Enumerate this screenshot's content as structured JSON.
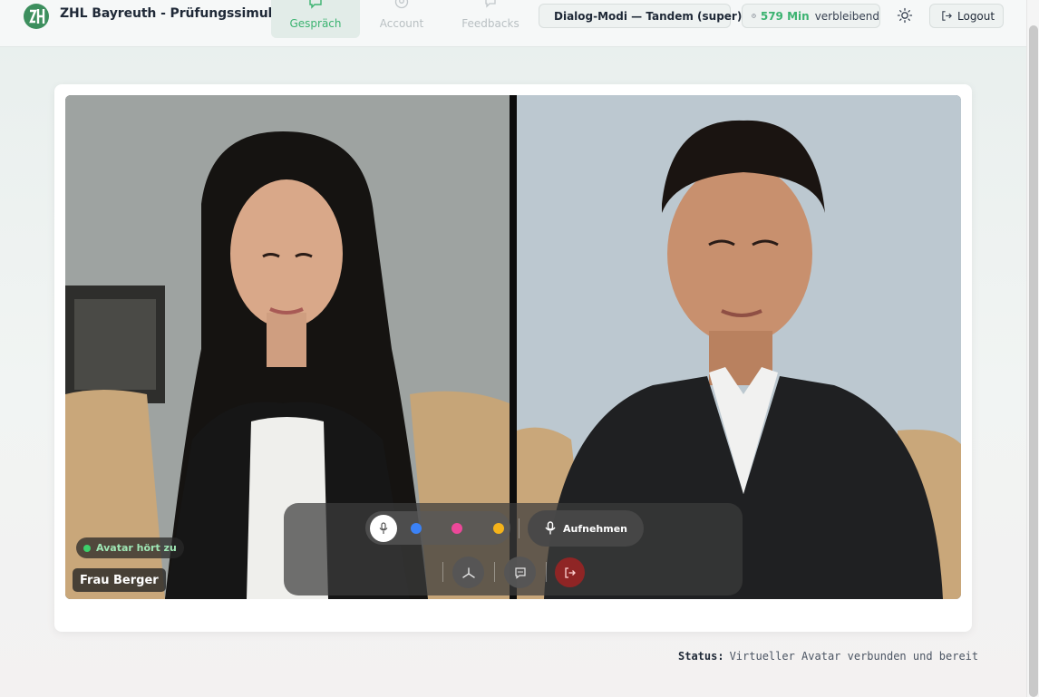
{
  "header": {
    "app_title": "ZHL Bayreuth - Prüfungssimulator",
    "logo_icon": "zhl-logo-icon",
    "tabs": [
      {
        "label": "Gespräch",
        "icon": "chat-icon",
        "active": true
      },
      {
        "label": "Account",
        "icon": "user-circle-icon",
        "active": false
      },
      {
        "label": "Feedbacks",
        "icon": "feedback-icon",
        "active": false
      }
    ],
    "mode_label": "Dialog-Modi — Tandem (super)",
    "time_minutes": "579 Min",
    "time_suffix": "verbleibend",
    "logout_label": "Logout"
  },
  "video": {
    "left_participant": {
      "status_badge": "Avatar hört zu",
      "name": "Frau Berger"
    },
    "right_participant": {}
  },
  "controls": {
    "voice_colors": [
      "#3b82f6",
      "#ec4899",
      "#f5b31a"
    ],
    "record_label": "Aufnehmen",
    "exit_color": "#8f2525"
  },
  "status": {
    "label": "Status:",
    "text": "Virtueller Avatar verbunden und bereit"
  },
  "colors": {
    "accent": "#3cb371",
    "badge_green": "#3dd06b"
  }
}
